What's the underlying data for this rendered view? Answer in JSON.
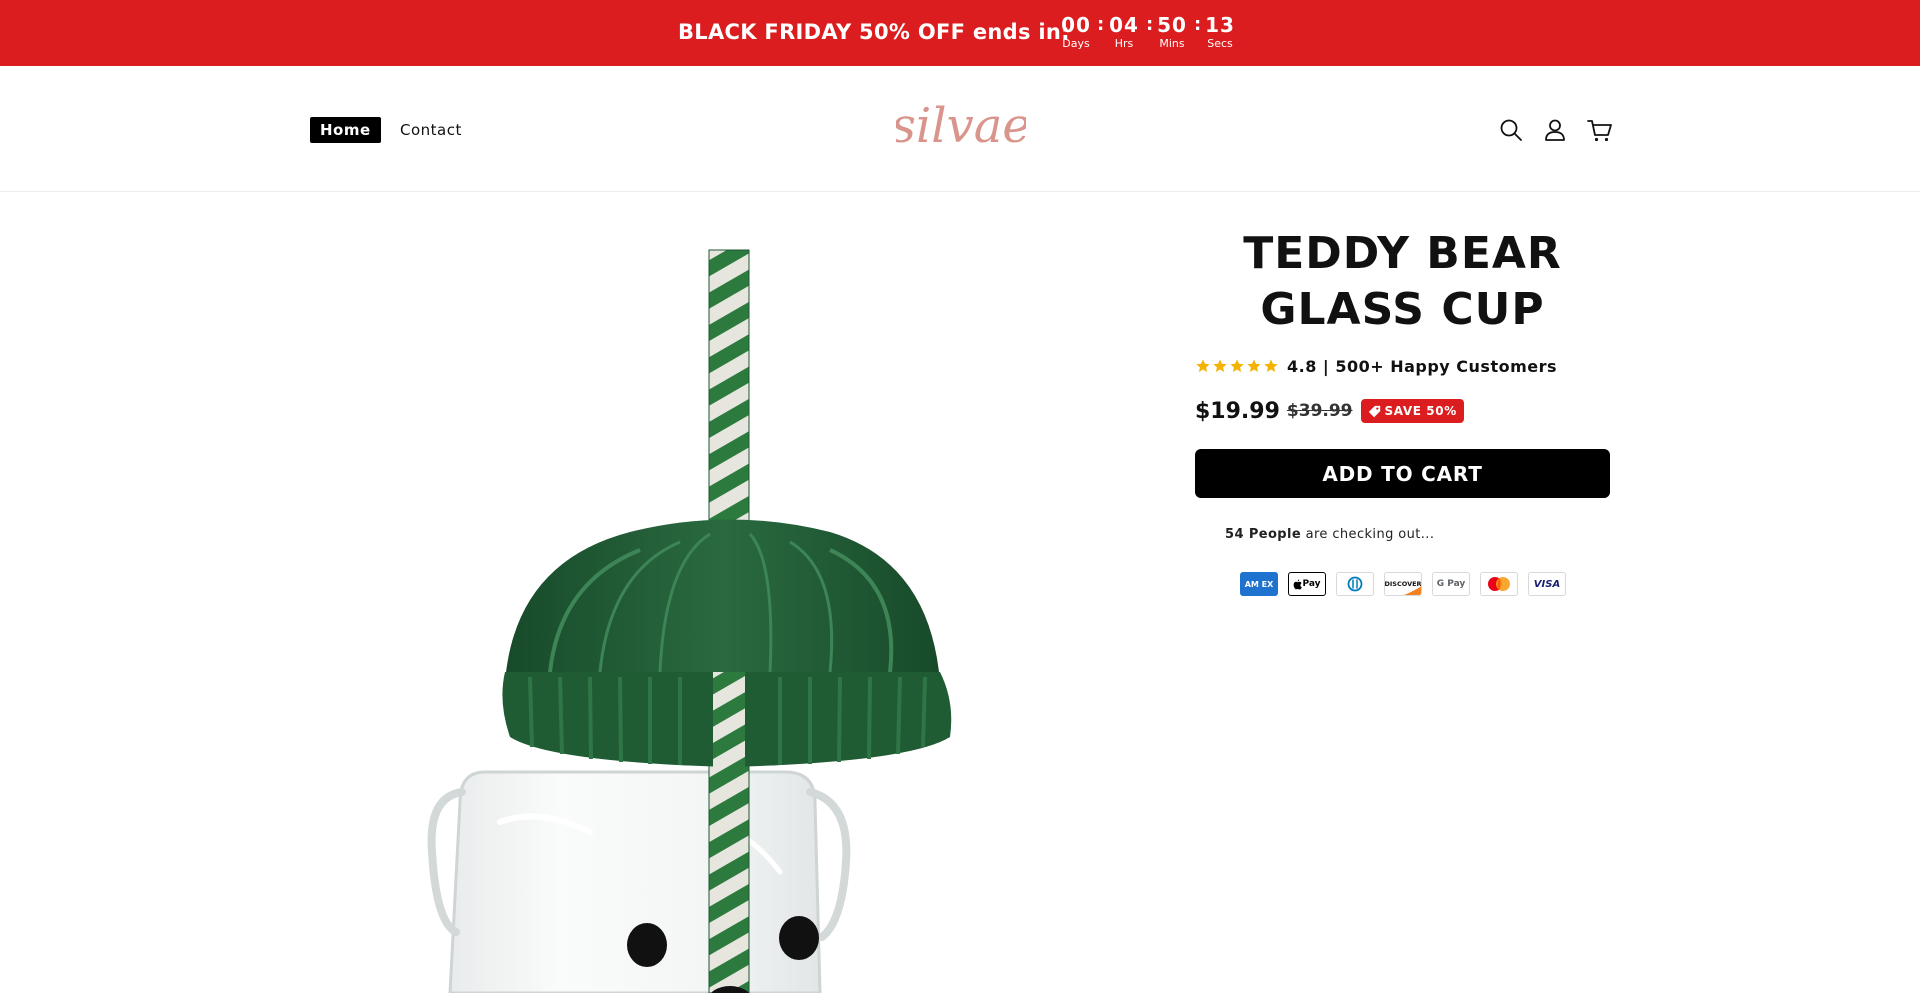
{
  "promo": {
    "text": "BLACK FRIDAY 50% OFF ends in:",
    "countdown": [
      {
        "value": "00",
        "label": "Days"
      },
      {
        "value": "04",
        "label": "Hrs"
      },
      {
        "value": "50",
        "label": "Mins"
      },
      {
        "value": "13",
        "label": "Secs"
      }
    ],
    "separator": ":"
  },
  "header": {
    "nav": [
      {
        "label": "Home",
        "active": true
      },
      {
        "label": "Contact",
        "active": false
      }
    ],
    "logo_text": "silvae",
    "icons": [
      "search-icon",
      "account-icon",
      "cart-icon"
    ]
  },
  "product": {
    "title": "TEDDY BEAR GLASS CUP",
    "rating": {
      "stars": 5,
      "text": "4.8 | 500+ Happy Customers"
    },
    "price": "$19.99",
    "compare_price": "$39.99",
    "save_badge": "SAVE 50%",
    "add_to_cart": "ADD TO CART",
    "checkout_count": "54 People",
    "checkout_text": " are checking out...",
    "payment_methods": [
      "American Express",
      "Apple Pay",
      "Diners Club",
      "Discover",
      "Google Pay",
      "Mastercard",
      "Visa"
    ],
    "payment_labels": {
      "amex": "AM EX",
      "applepay": "Pay",
      "discover": "DISCOVER",
      "gpay": "G Pay",
      "visa": "VISA"
    }
  },
  "colors": {
    "promo_bg": "#dc1d1f",
    "logo": "#d9958c",
    "star": "#f5b301",
    "button_bg": "#000000",
    "lid_green": "#1f5c34"
  }
}
